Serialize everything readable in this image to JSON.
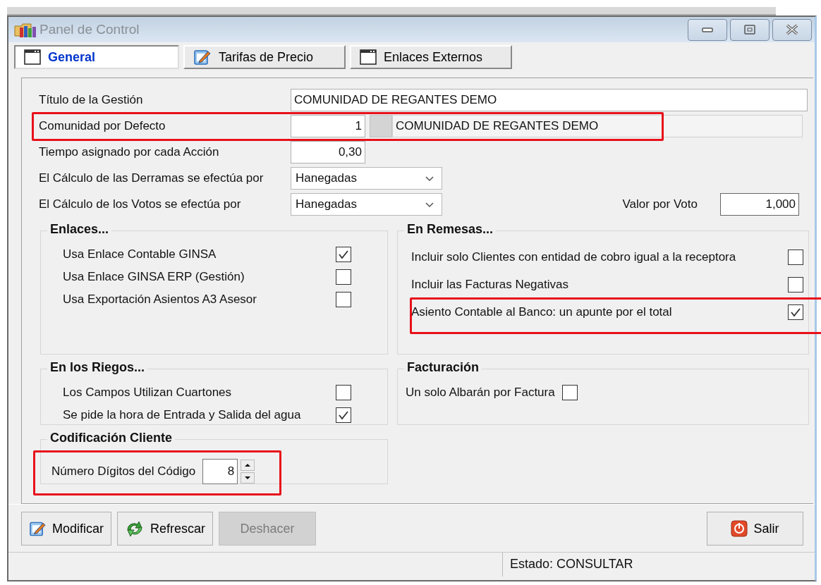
{
  "window": {
    "title": "Panel de Control"
  },
  "tabs": [
    {
      "label": "General",
      "selected": true
    },
    {
      "label": "Tarifas de Precio",
      "selected": false
    },
    {
      "label": "Enlaces Externos",
      "selected": false
    }
  ],
  "fields": [
    {
      "kind": "text",
      "label": "Título de la Gestión",
      "value": "COMUNIDAD DE REGANTES DEMO",
      "highlighted": false
    },
    {
      "kind": "lookup",
      "label": "Comunidad por Defecto",
      "value": "1",
      "description": "COMUNIDAD DE REGANTES DEMO",
      "highlighted": true
    },
    {
      "kind": "number",
      "label": "Tiempo asignado por cada Acción",
      "value": "0,30",
      "highlighted": false
    },
    {
      "kind": "combo",
      "label": "El Cálculo de las Derramas se efectúa por",
      "value": "Hanegadas",
      "highlighted": false
    },
    {
      "kind": "combo",
      "label": "El Cálculo de los Votos se efectúa por",
      "value": "Hanegadas",
      "extra_label": "Valor por Voto",
      "extra_value": "1,000",
      "highlighted": false
    }
  ],
  "groups": [
    {
      "kind": "checklist",
      "title": "Enlaces...",
      "items": [
        {
          "label": "Usa Enlace Contable GINSA",
          "checked": true,
          "highlighted": false
        },
        {
          "label": "Usa Enlace GINSA ERP (Gestión)",
          "checked": false,
          "highlighted": false
        },
        {
          "label": "Usa Exportación Asientos A3 Asesor",
          "checked": false,
          "highlighted": false
        }
      ]
    },
    {
      "kind": "checklist",
      "title": "En Remesas...",
      "items": [
        {
          "label": "Incluir solo Clientes con entidad de cobro igual a la receptora",
          "checked": false,
          "highlighted": false
        },
        {
          "label": "Incluir las Facturas Negativas",
          "checked": false,
          "highlighted": false
        },
        {
          "label": "Asiento Contable al  Banco: un apunte por el total",
          "checked": true,
          "highlighted": true
        }
      ]
    },
    {
      "kind": "checklist",
      "title": "En los Riegos...",
      "items": [
        {
          "label": "Los Campos Utilizan Cuartones",
          "checked": false,
          "highlighted": false
        },
        {
          "label": "Se pide la hora de Entrada y Salida del agua",
          "checked": true,
          "highlighted": false
        }
      ]
    },
    {
      "kind": "inline",
      "title": "Facturación",
      "items": [
        {
          "label": "Un solo Albarán por Factura",
          "checked": false,
          "highlighted": false
        }
      ]
    },
    {
      "kind": "spinner",
      "title": "Codificación Cliente",
      "label": "Número Dígitos del Código",
      "value": "8",
      "highlighted": true
    }
  ],
  "buttons": [
    {
      "label": "Modificar",
      "disabled": false
    },
    {
      "label": "Refrescar",
      "disabled": false
    },
    {
      "label": "Deshacer",
      "disabled": true
    },
    {
      "label": "Salir",
      "disabled": false
    }
  ],
  "status_bar": {
    "text": "Estado: CONSULTAR"
  }
}
